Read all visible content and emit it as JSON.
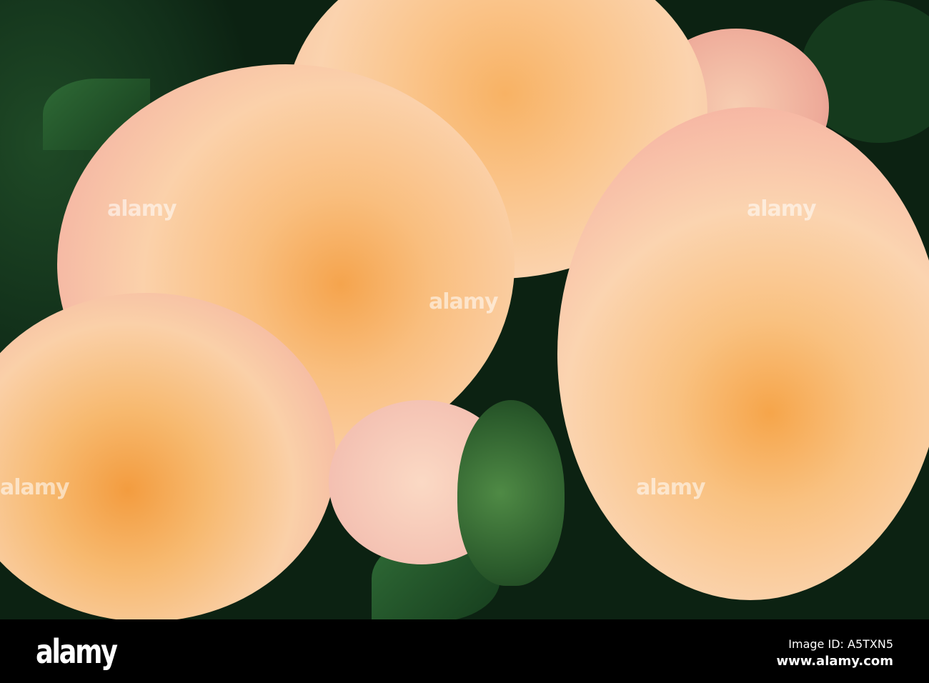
{
  "photo": {
    "subject": "peach roses"
  },
  "watermark": {
    "text": "alamy"
  },
  "footer": {
    "logo": "alamy",
    "image_id": "Image ID: A5TXN5",
    "url": "www.alamy.com"
  }
}
